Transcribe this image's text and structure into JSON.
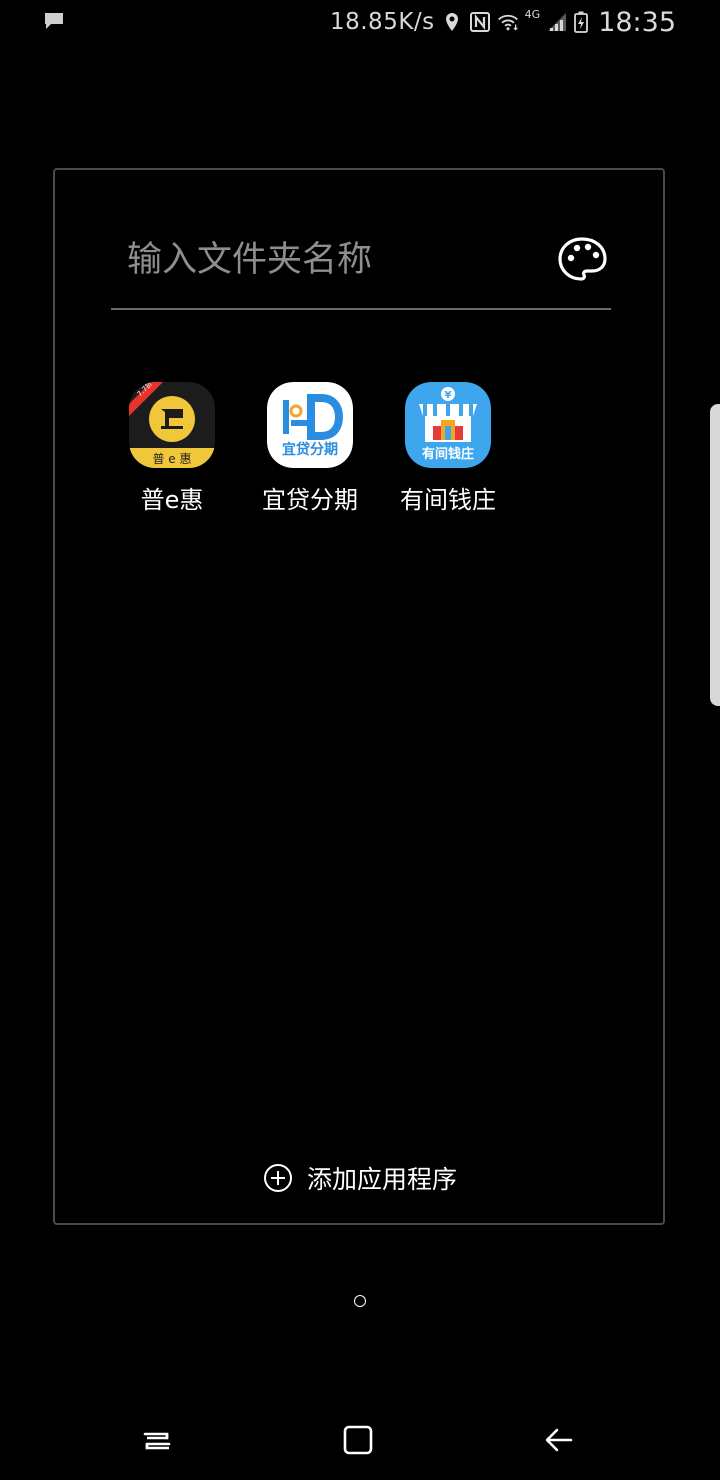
{
  "status_bar": {
    "speed": "18.85K/s",
    "network": "4G",
    "time": "18:35",
    "icons": [
      "message-icon",
      "location-icon",
      "nfc-icon",
      "wifi-icon",
      "signal-icon",
      "battery-icon"
    ]
  },
  "folder": {
    "name_placeholder": "输入文件夹名称",
    "palette_icon": "palette-icon",
    "apps": [
      {
        "label": "普e惠",
        "badge": "7.7折",
        "icon_text": "普 e 惠",
        "icon": "pu-e-hui-app-icon"
      },
      {
        "label": "宜贷分期",
        "icon_text": "宜贷分期",
        "icon": "yi-dai-fen-qi-app-icon"
      },
      {
        "label": "有间钱庄",
        "icon_text": "有间钱庄",
        "icon": "you-jian-qian-zhuang-app-icon"
      }
    ],
    "add_label": "添加应用程序"
  },
  "colors": {
    "background": "#000000",
    "folder_border": "#4a4a4a",
    "divider": "#6a6a6a",
    "placeholder": "#8e8e8e"
  },
  "nav": {
    "icons": [
      "recents-icon",
      "home-icon",
      "back-icon"
    ]
  }
}
